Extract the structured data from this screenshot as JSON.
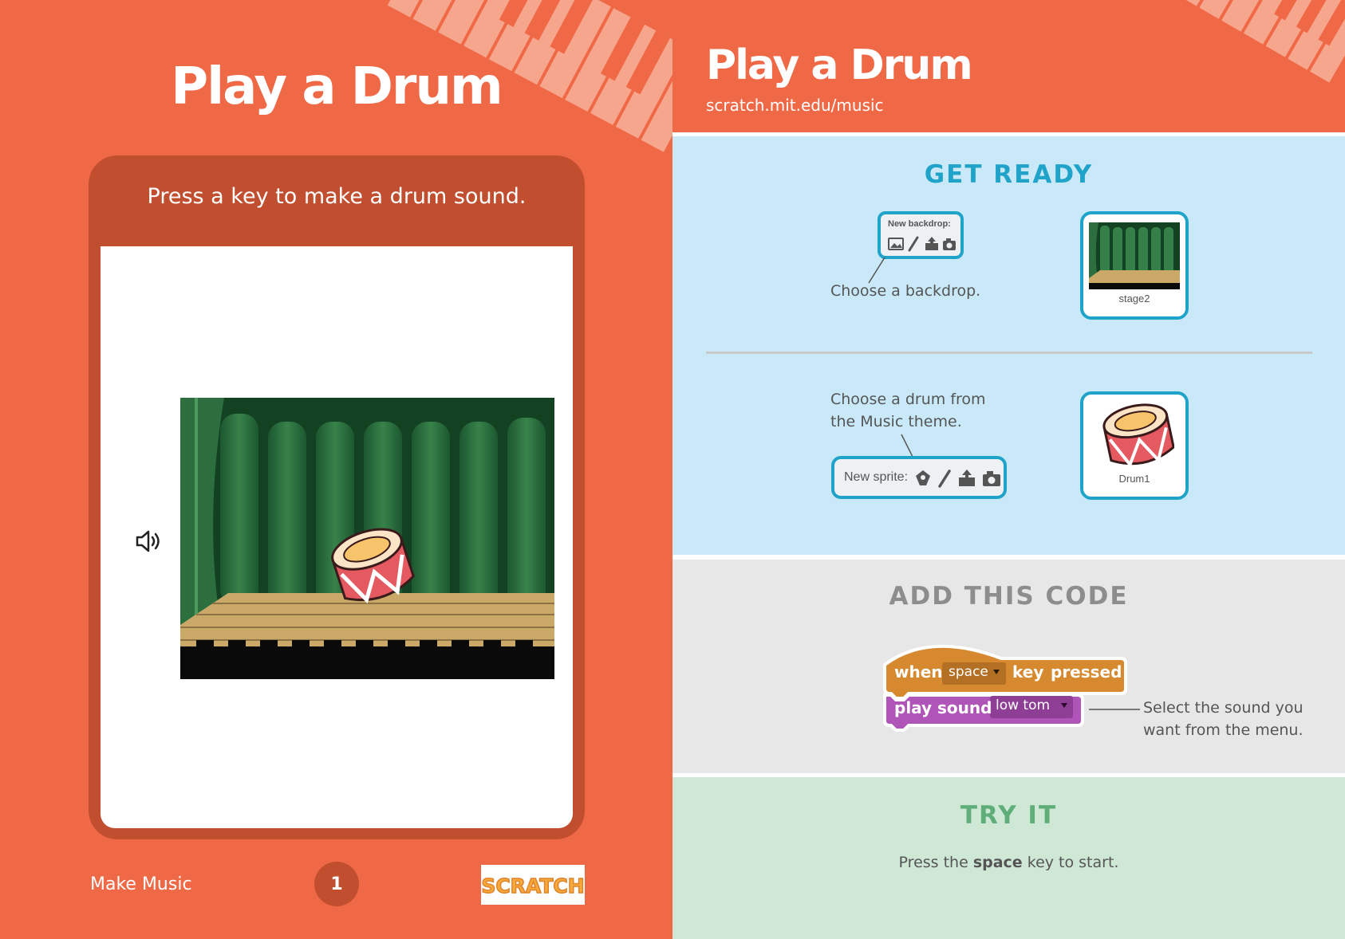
{
  "left": {
    "title": "Play a Drum",
    "card_instruction": "Press a key to make a drum sound.",
    "footer_label": "Make Music",
    "page_number": "1",
    "logo_text": "SCRATCH"
  },
  "right": {
    "title": "Play a Drum",
    "url": "scratch.mit.edu/music",
    "get_ready": {
      "heading": "GET READY",
      "backdrop_panel_label": "New backdrop:",
      "backdrop_caption": "Choose a backdrop.",
      "stage_thumb_label": "stage2",
      "drum_caption_line1": "Choose a drum from",
      "drum_caption_line2": "the Music theme.",
      "sprite_panel_label": "New sprite:",
      "drum_thumb_label": "Drum1"
    },
    "add_code": {
      "heading": "ADD THIS CODE",
      "hat_block": {
        "word1": "when",
        "key_value": "space",
        "word2": "key",
        "word3": "pressed"
      },
      "sound_block": {
        "word1": "play",
        "word2": "sound",
        "sound_value": "low tom"
      },
      "caption_line1": "Select the sound you",
      "caption_line2": "want from the menu."
    },
    "try_it": {
      "heading": "TRY IT",
      "text_before": "Press the ",
      "text_bold": "space",
      "text_after": " key to start."
    }
  },
  "colors": {
    "orange": "#f06947",
    "dark_orange": "#c14e2e",
    "ready_bg": "#c9e9f9",
    "code_bg": "#e7e7e7",
    "try_bg": "#cfe8d6",
    "blue_accent": "#1fa3c9",
    "events_block": "#d6892f",
    "sound_block": "#b055b8"
  }
}
